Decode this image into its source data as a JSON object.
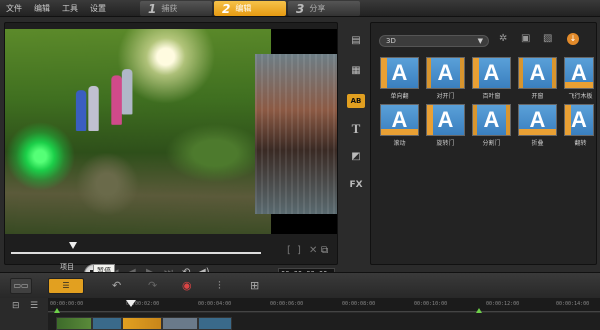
{
  "menu": {
    "items": [
      "文件",
      "编辑",
      "工具",
      "设置"
    ]
  },
  "steps": [
    {
      "num": "1",
      "label": "捕获",
      "active": false
    },
    {
      "num": "2",
      "label": "编辑",
      "active": true
    },
    {
      "num": "3",
      "label": "分享",
      "active": false
    }
  ],
  "preview": {
    "mode_project": "项目",
    "mode_clip": "素材",
    "timecode": "00:00:00:06",
    "tooltip": "暂停"
  },
  "library": {
    "category": "3D",
    "icons": [
      "media-icon",
      "instant-project-icon",
      "transition-icon",
      "title-icon",
      "graphic-icon",
      "filter-icon"
    ],
    "icon_labels": {
      "fx": "FX",
      "title": "T",
      "ab": "AB"
    },
    "thumb_glyph": "A",
    "thumbnails": [
      [
        "单向翻",
        "对开门",
        "百叶窗",
        "开窗",
        "飞行木板"
      ],
      [
        "滚动",
        "旋转门",
        "分割门",
        "折叠",
        "翻转"
      ]
    ]
  },
  "timeline": {
    "ruler_ticks": [
      "00:00:00:00",
      "00:00:02:00",
      "00:00:04:00",
      "00:00:06:00",
      "00:00:08:00",
      "00:00:10:00",
      "00:00:12:00",
      "00:00:14:00"
    ]
  },
  "colors": {
    "accent": "#e2a020",
    "thumb_blue": "#3a7fbf",
    "marker_green": "#6ed04a"
  }
}
